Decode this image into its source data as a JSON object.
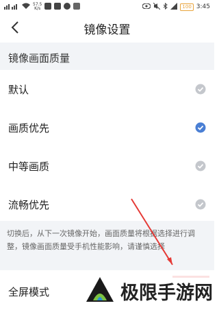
{
  "status_bar": {
    "net_speed": "57.5",
    "net_unit": "K/s",
    "battery": "100",
    "time": "3:45"
  },
  "header": {
    "title": "镜像设置"
  },
  "quality_section": {
    "title": "镜像画面质量",
    "options": [
      {
        "label": "默认",
        "selected": false
      },
      {
        "label": "画质优先",
        "selected": true
      },
      {
        "label": "中等画质",
        "selected": false
      },
      {
        "label": "流畅优先",
        "selected": false
      }
    ],
    "note": "切换后，从下一次镜像开始，画面质量将根据选择进行调整，镜像画面质量受手机性能影响，请谨慎选择"
  },
  "fullscreen": {
    "label": "全屏模式"
  },
  "watermark": {
    "text": "极限手游网"
  },
  "colors": {
    "checked": "#4a7fd4",
    "unchecked": "#c4c7cc",
    "section_bg": "#f2f4f7",
    "annotation_red": "#e53935"
  }
}
